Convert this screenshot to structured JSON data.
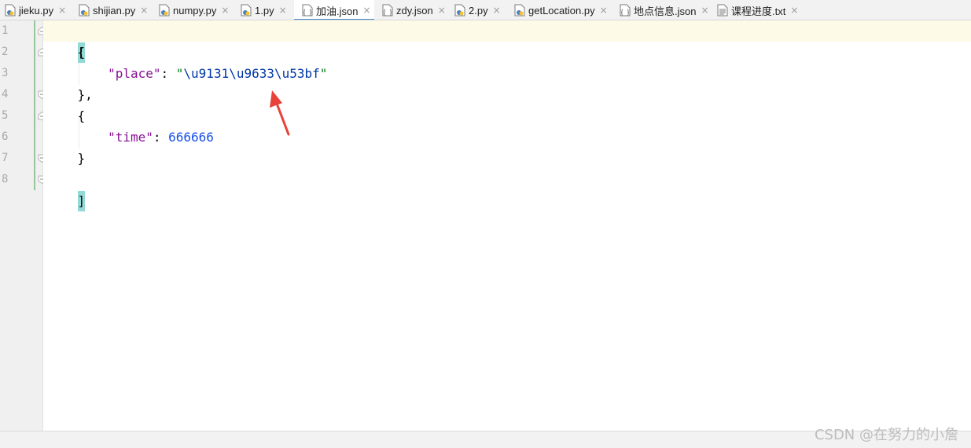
{
  "tabs": [
    {
      "label": "jieku.py",
      "icon": "python-file-icon",
      "active": false
    },
    {
      "label": "shijian.py",
      "icon": "python-file-icon",
      "active": false
    },
    {
      "label": "numpy.py",
      "icon": "python-file-icon",
      "active": false
    },
    {
      "label": "1.py",
      "icon": "python-file-icon",
      "active": false
    },
    {
      "label": "加油.json",
      "icon": "json-file-icon",
      "active": true
    },
    {
      "label": "zdy.json",
      "icon": "json-file-icon",
      "active": false
    },
    {
      "label": "2.py",
      "icon": "python-file-icon",
      "active": false
    },
    {
      "label": "getLocation.py",
      "icon": "python-file-icon",
      "active": false
    },
    {
      "label": "地点信息.json",
      "icon": "json-file-icon",
      "active": false
    },
    {
      "label": "课程进度.txt",
      "icon": "text-file-icon",
      "active": false
    }
  ],
  "close_glyph": "×",
  "editor": {
    "line_numbers": [
      "1",
      "2",
      "3",
      "4",
      "5",
      "6",
      "7",
      "8"
    ],
    "lines": {
      "l1": {
        "bracket": "["
      },
      "l2": {
        "text": "    {"
      },
      "l3": {
        "indent": "        ",
        "key": "\"place\"",
        "sep": ": ",
        "quote_open": "\"",
        "value": "\\u9131\\u9633\\u53bf",
        "quote_close": "\""
      },
      "l4": {
        "text": "    },"
      },
      "l5": {
        "text": "    {"
      },
      "l6": {
        "indent": "        ",
        "key": "\"time\"",
        "sep": ": ",
        "value": "666666"
      },
      "l7": {
        "text": "    }"
      },
      "l8": {
        "bracket": "]"
      }
    }
  },
  "colors": {
    "json_key": "#871094",
    "json_string": "#067d17",
    "escape_sequence": "#0037a6",
    "json_number": "#1750eb",
    "bracket_highlight": "#93d9d6",
    "annotation_arrow": "#e8423a",
    "active_tab_underline": "#4a86c8"
  },
  "watermark": "CSDN @在努力的小詹"
}
